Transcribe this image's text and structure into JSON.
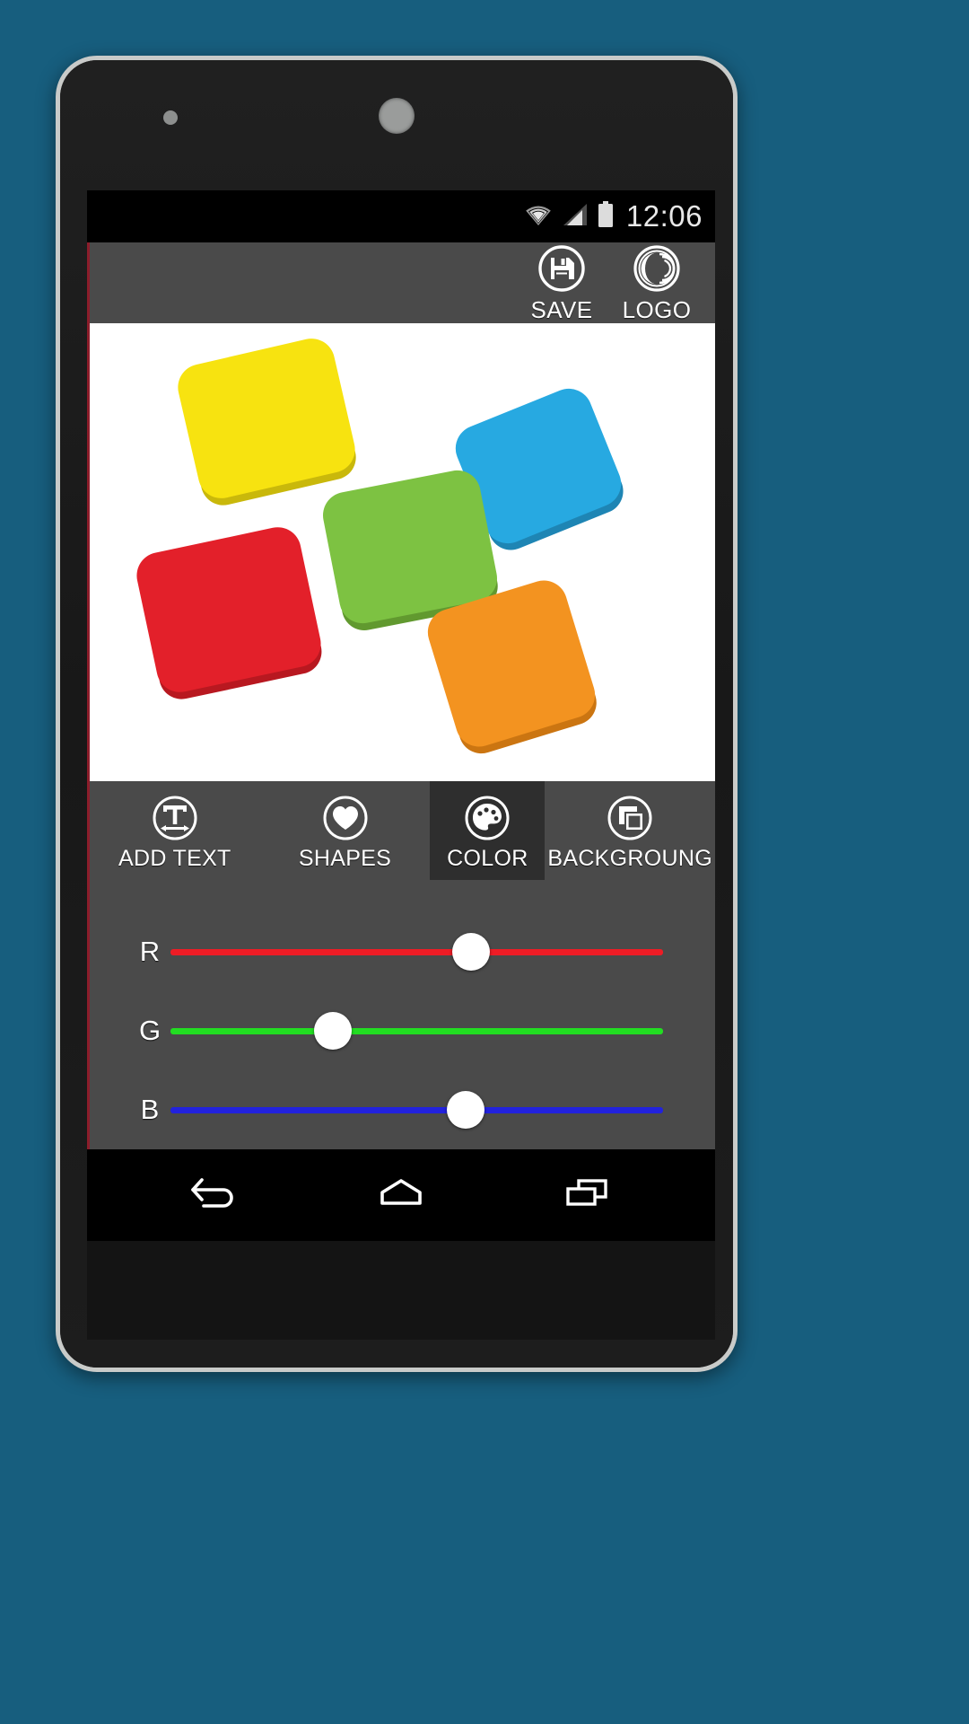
{
  "device": {
    "body_color": "#1b1b1b",
    "bezel_color": "#c9cbc9",
    "page_background": "#175E7E"
  },
  "statusbar": {
    "time": "12:06",
    "icons": [
      "wifi-icon",
      "cellular-signal-icon",
      "battery-icon"
    ]
  },
  "appbar": {
    "background": "#4a4a4a",
    "accent_stripe": "#8c1d2b",
    "buttons": [
      {
        "id": "save",
        "label": "SAVE",
        "icon": "floppy-disk-save-icon"
      },
      {
        "id": "logo",
        "label": "LOGO",
        "icon": "logo-swirl-icon"
      }
    ]
  },
  "canvas": {
    "background": "#ffffff",
    "shapes": [
      {
        "name": "yellow-rounded-square",
        "color": "#F7E310",
        "shadow": "#C9B80B"
      },
      {
        "name": "blue-rounded-rect",
        "color": "#27A9E1",
        "shadow": "#1E85B4"
      },
      {
        "name": "green-rounded-rect",
        "color": "#7DC242",
        "shadow": "#61992F"
      },
      {
        "name": "red-rounded-square",
        "color": "#E3202A",
        "shadow": "#B81820"
      },
      {
        "name": "orange-rounded-rect",
        "color": "#F39320",
        "shadow": "#CB7511"
      }
    ]
  },
  "toolstrip": {
    "active_tool": "COLOR",
    "tools": [
      {
        "id": "add-text",
        "label": "ADD TEXT",
        "icon": "text-tool-icon",
        "active": false
      },
      {
        "id": "shapes",
        "label": "SHAPES",
        "icon": "heart-shape-icon",
        "active": false
      },
      {
        "id": "color",
        "label": "COLOR",
        "icon": "paint-palette-icon",
        "active": true
      },
      {
        "id": "background",
        "label": "BACKGROUNG",
        "icon": "layers-background-icon",
        "active": false
      }
    ]
  },
  "sliders": {
    "panel_background": "#4a4a4a",
    "min": 0,
    "max": 255,
    "channels": [
      {
        "id": "r",
        "label": "R",
        "color": "#EE1C25",
        "value": 155,
        "percent": 61
      },
      {
        "id": "g",
        "label": "G",
        "color": "#22DD22",
        "value": 84,
        "percent": 33
      },
      {
        "id": "b",
        "label": "B",
        "color": "#2222DD",
        "value": 153,
        "percent": 60
      }
    ]
  },
  "navbar": {
    "background": "#000000",
    "buttons": [
      {
        "id": "back",
        "label": "Back",
        "icon": "back-arrow-icon"
      },
      {
        "id": "home",
        "label": "Home",
        "icon": "home-icon"
      },
      {
        "id": "recents",
        "label": "Recents",
        "icon": "recents-icon"
      }
    ]
  }
}
